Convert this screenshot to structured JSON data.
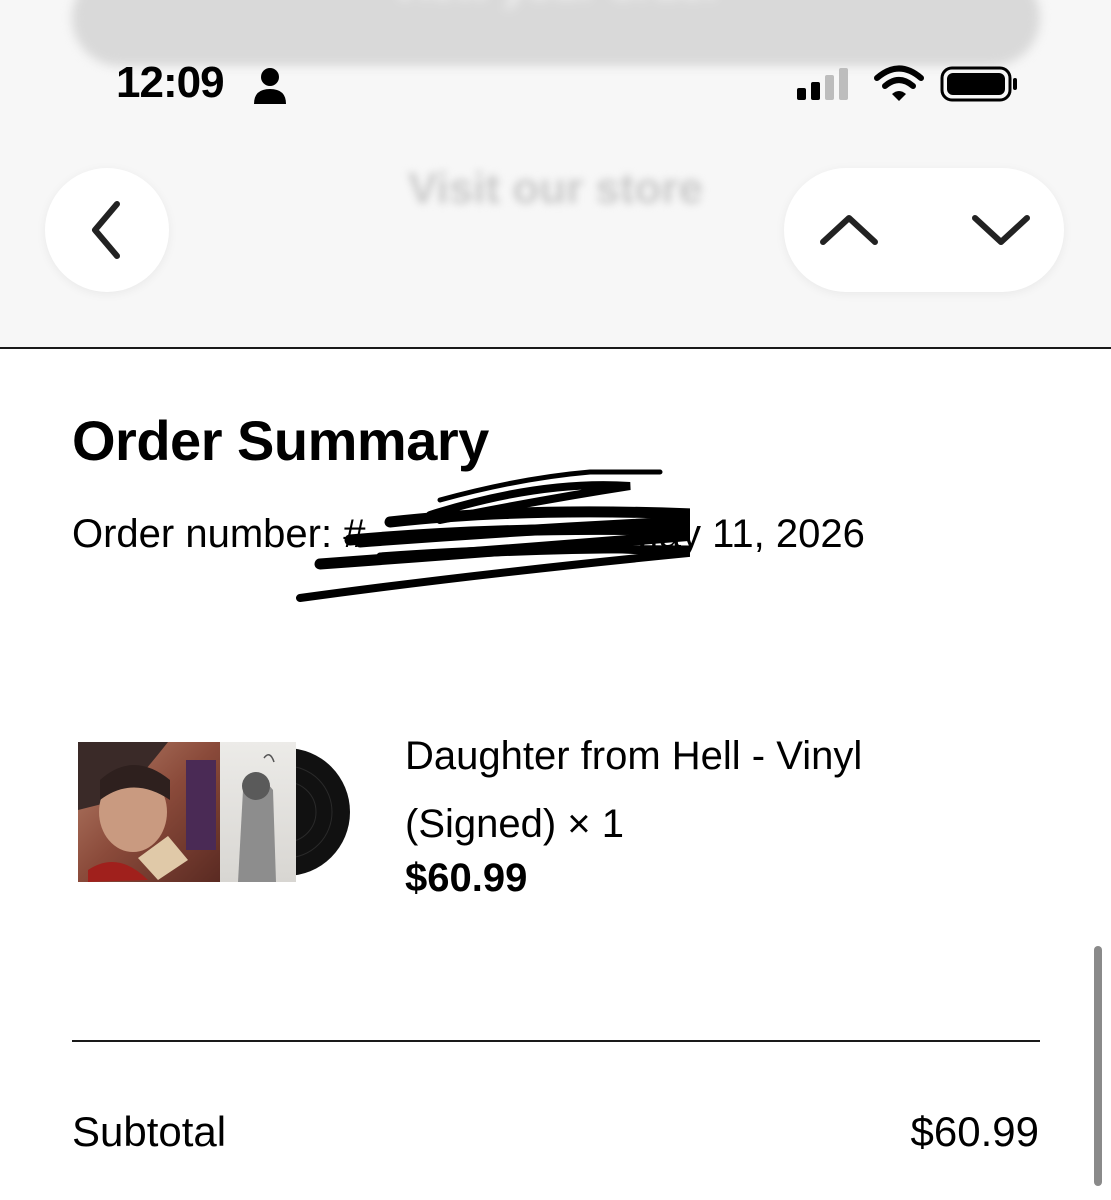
{
  "status_bar": {
    "time": "12:09",
    "icons": [
      "person-icon",
      "cellular-signal-icon",
      "wifi-icon",
      "battery-icon"
    ]
  },
  "header": {
    "view_order_label": "View your order",
    "visit_store_label": "Visit our store",
    "icons": [
      "chevron-left-icon",
      "chevron-up-icon",
      "chevron-down-icon"
    ]
  },
  "summary": {
    "title": "Order Summary",
    "order_label": "Order number: #",
    "order_date": "May 11, 2026"
  },
  "item": {
    "name": "Daughter from Hell - Vinyl (Signed) × 1",
    "price": "$60.99"
  },
  "totals": {
    "subtotal_label": "Subtotal",
    "subtotal_value": "$60.99"
  }
}
